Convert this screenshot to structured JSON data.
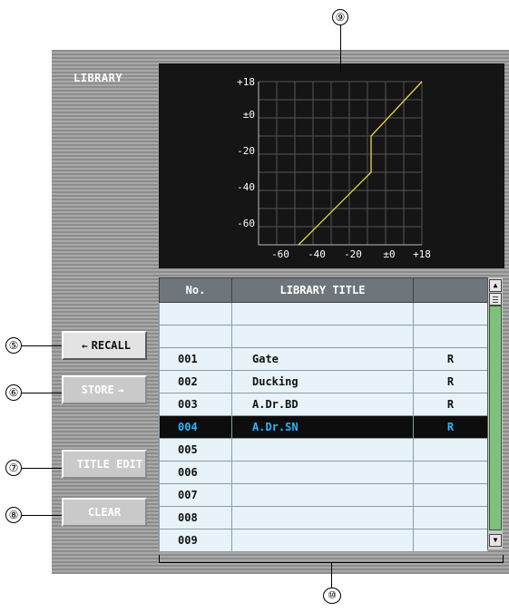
{
  "library_label": "LIBRARY",
  "callouts": {
    "c5": "⑤",
    "c6": "⑥",
    "c7": "⑦",
    "c8": "⑧",
    "c9": "⑨",
    "c10": "⑩"
  },
  "buttons": {
    "recall": "RECALL",
    "store": "STORE",
    "title_edit": "TITLE EDIT",
    "clear": "CLEAR"
  },
  "graph": {
    "y_ticks": [
      "+18",
      "±0",
      "-20",
      "-40",
      "-60"
    ],
    "x_ticks": [
      "-60",
      "-40",
      "-20",
      "±0",
      "+18"
    ],
    "curve_color": "#e8d84a",
    "grid_color": "#555555"
  },
  "table": {
    "headers": {
      "no": "No.",
      "title": "LIBRARY TITLE",
      "flag": ""
    },
    "rows": [
      {
        "no": "",
        "title": "",
        "flag": ""
      },
      {
        "no": "",
        "title": "",
        "flag": ""
      },
      {
        "no": "001",
        "title": "Gate",
        "flag": "R"
      },
      {
        "no": "002",
        "title": "Ducking",
        "flag": "R"
      },
      {
        "no": "003",
        "title": "A.Dr.BD",
        "flag": "R"
      },
      {
        "no": "004",
        "title": "A.Dr.SN",
        "flag": "R",
        "selected": true
      },
      {
        "no": "005",
        "title": "",
        "flag": ""
      },
      {
        "no": "006",
        "title": "",
        "flag": ""
      },
      {
        "no": "007",
        "title": "",
        "flag": ""
      },
      {
        "no": "008",
        "title": "",
        "flag": ""
      },
      {
        "no": "009",
        "title": "",
        "flag": ""
      }
    ]
  }
}
